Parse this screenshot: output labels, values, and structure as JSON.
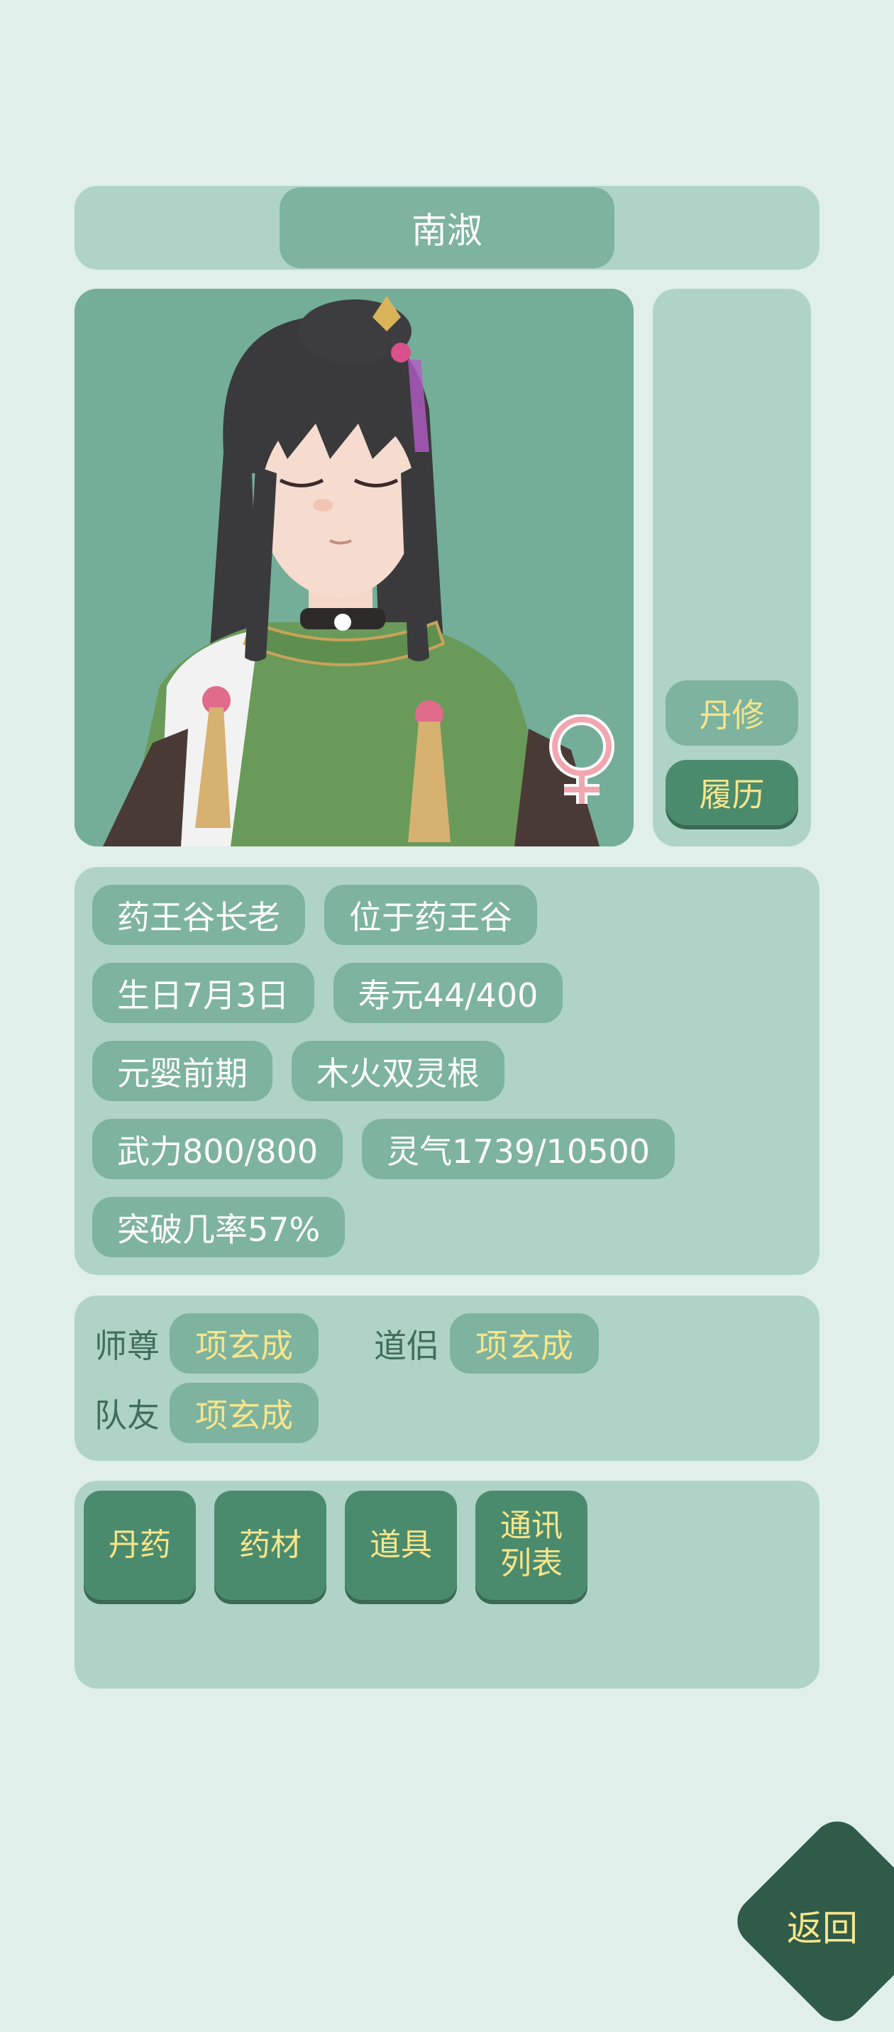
{
  "header": {
    "name": "南淑"
  },
  "portrait": {
    "gender_icon": "female-symbol-icon"
  },
  "side": {
    "role": "丹修",
    "resume": "履历"
  },
  "attributes": {
    "row1": [
      "药王谷长老",
      "位于药王谷"
    ],
    "row2": [
      "生日7月3日",
      "寿元44/400"
    ],
    "row3": [
      "元婴前期",
      "木火双灵根"
    ],
    "row4": [
      "武力800/800",
      "灵气1739/10500"
    ],
    "row5": [
      "突破几率57%"
    ]
  },
  "relations": {
    "master_label": "师尊",
    "master_name": "项玄成",
    "partner_label": "道侣",
    "partner_name": "项玄成",
    "teammate_label": "队友",
    "teammate_name": "项玄成"
  },
  "inventory": {
    "pills": "丹药",
    "herbs": "药材",
    "items": "道具",
    "contacts_line1": "通讯",
    "contacts_line2": "列表"
  },
  "back": "返回",
  "colors": {
    "background": "#e0efe9",
    "panel": "#afd3c7",
    "chip": "#7db39f",
    "button_dark": "#4b8b6d",
    "accent_text": "#f6e58c"
  }
}
